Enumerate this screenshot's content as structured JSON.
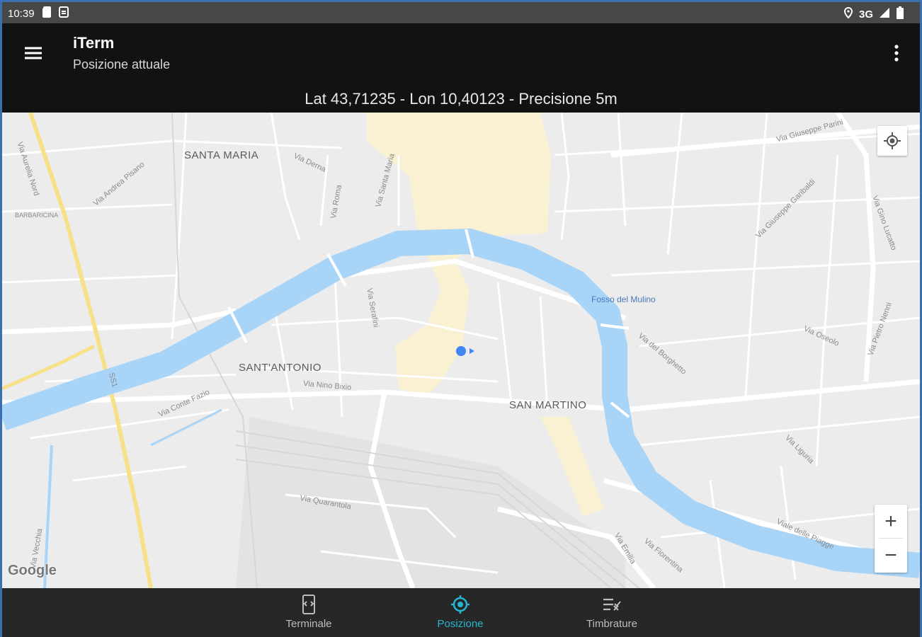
{
  "status_bar": {
    "time": "10:39",
    "network": "3G",
    "icons": [
      "sd-card-icon",
      "download-icon",
      "location-icon",
      "signal-icon",
      "battery-icon"
    ]
  },
  "app_bar": {
    "title": "iTerm",
    "subtitle": "Posizione attuale",
    "menu_icon": "hamburger-menu-icon",
    "overflow_icon": "more-vertical-icon"
  },
  "location_info": "Lat 43,71235 - Lon 10,40123 - Precisione 5m",
  "map": {
    "areas": [
      "SANTA MARIA",
      "SANT'ANTONIO",
      "SAN MARTINO"
    ],
    "small_labels": [
      "BARBARICINA"
    ],
    "water_label": "Fosso del Mulino",
    "streets": [
      "Via Aurelia Nord",
      "Via Andrea Pisano",
      "Via Derna",
      "Via Roma",
      "Via Santa Maria",
      "Via Giuseppe Parini",
      "Via Giuseppe Garibaldi",
      "Via Gino Lucatto",
      "Via Serafini",
      "Via del Borghetto",
      "Via Oseolo",
      "Via Pietro Nenni",
      "Via Nino Bixio",
      "Via Conte Fazio",
      "SS1",
      "Via Quarantola",
      "Via Emilia",
      "Via Fiorentina",
      "Via Liguria",
      "Viale delle Piagge",
      "Via Vecchia"
    ],
    "attribution": "Google",
    "my_location_icon": "my-location-icon",
    "zoom_in": "+",
    "zoom_out": "−",
    "colors": {
      "water": "#a8d4f7",
      "land": "#ececec",
      "road": "#ffffff",
      "highway": "#f7e08a",
      "pin": "#4285f4"
    }
  },
  "bottom_nav": {
    "items": [
      {
        "label": "Terminale",
        "icon": "phone-terminal-icon",
        "active": false
      },
      {
        "label": "Posizione",
        "icon": "gps-target-icon",
        "active": true
      },
      {
        "label": "Timbrature",
        "icon": "checklist-icon",
        "active": false
      }
    ],
    "active_color": "#25b6d2"
  }
}
